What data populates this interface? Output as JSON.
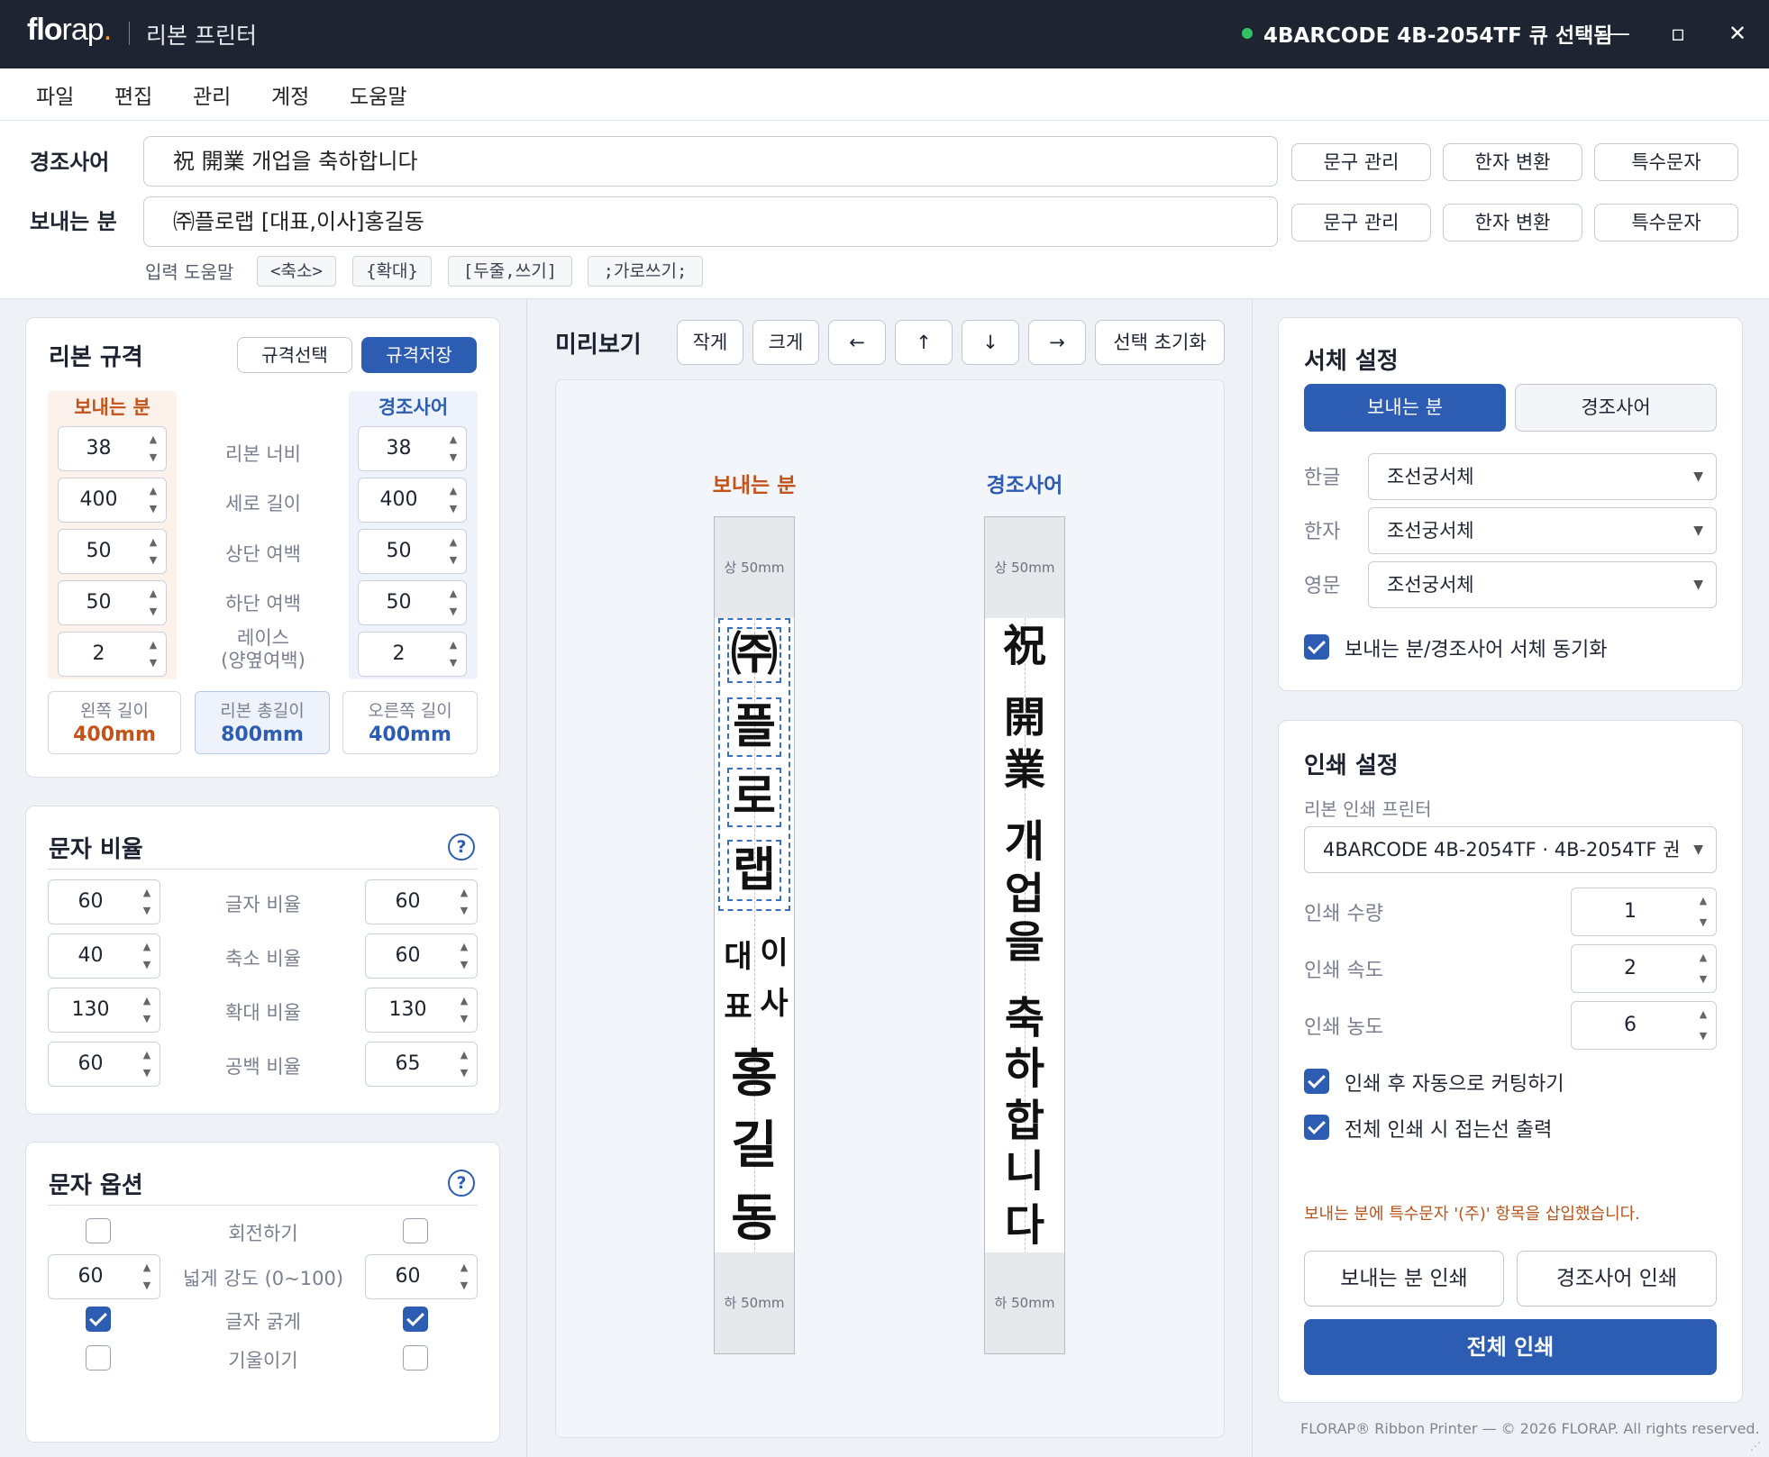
{
  "titlebar": {
    "logo_main": "flo",
    "logo_rest": "rap",
    "logo_dot": ".",
    "app_title": "리본 프린터",
    "printer_status": "4BARCODE 4B-2054TF 큐 선택됨",
    "minimize": "—",
    "maximize": "▫",
    "close": "✕",
    "status_color": "#31c264"
  },
  "menu": [
    "파일",
    "편집",
    "관리",
    "계정",
    "도움말"
  ],
  "inputs": {
    "condolence_label": "경조사어",
    "condolence_value": "祝 開業 개업을 축하합니다",
    "sender_label": "보내는 분",
    "sender_value": "㈜플로랩 [대표,이사]홍길동",
    "phrase_manage": "문구 관리",
    "hanja_convert": "한자 변환",
    "special_char": "특수문자",
    "help_label": "입력 도움말",
    "chips": [
      "<축소>",
      "{확대}",
      "[두줄,쓰기]",
      ";가로쓰기;"
    ]
  },
  "ribbon_spec": {
    "title": "리본 규격",
    "select_btn": "규격선택",
    "save_btn": "규격저장",
    "sender_head": "보내는 분",
    "condolence_head": "경조사어",
    "rows": [
      {
        "label": "리본 너비",
        "sender": "38",
        "condolence": "38"
      },
      {
        "label": "세로 길이",
        "sender": "400",
        "condolence": "400"
      },
      {
        "label": "상단 여백",
        "sender": "50",
        "condolence": "50"
      },
      {
        "label": "하단 여백",
        "sender": "50",
        "condolence": "50"
      },
      {
        "label": "레이스\n(양옆여백)",
        "sender": "2",
        "condolence": "2"
      }
    ],
    "left_len_label": "왼쪽 길이",
    "left_len": "400mm",
    "total_len_label": "리본 총길이",
    "total_len": "800mm",
    "right_len_label": "오른쪽 길이",
    "right_len": "400mm"
  },
  "char_ratio": {
    "title": "문자 비율",
    "help": "?",
    "rows": [
      {
        "label": "글자 비율",
        "left": "60",
        "right": "60"
      },
      {
        "label": "축소 비율",
        "left": "40",
        "right": "60"
      },
      {
        "label": "확대 비율",
        "left": "130",
        "right": "130"
      },
      {
        "label": "공백 비율",
        "left": "60",
        "right": "65"
      }
    ]
  },
  "char_options": {
    "title": "문자 옵션",
    "help": "?",
    "rotate_label": "회전하기",
    "rotate_left": false,
    "rotate_right": false,
    "spread_label": "넓게 강도 (0~100)",
    "spread_left": "60",
    "spread_right": "60",
    "bold_label": "글자 굵게",
    "bold_left": true,
    "bold_right": true,
    "italic_label": "기울이기",
    "italic_left": false,
    "italic_right": false
  },
  "preview": {
    "title": "미리보기",
    "smaller": "작게",
    "bigger": "크게",
    "left": "←",
    "up": "↑",
    "down": "↓",
    "right": "→",
    "reset": "선택 초기화",
    "sender_label": "보내는 분",
    "condolence_label": "경조사어",
    "top_margin": "상 50mm",
    "bottom_margin": "하 50mm",
    "sender_big": [
      "㈜",
      "플",
      "로",
      "랩"
    ],
    "sender_small_left": [
      "대",
      "표"
    ],
    "sender_small_right": [
      "이",
      "사"
    ],
    "sender_name": [
      "홍",
      "길",
      "동"
    ],
    "condolence_chars": [
      "祝",
      "開",
      "業",
      "개",
      "업",
      "을",
      "축",
      "하",
      "합",
      "니",
      "다"
    ]
  },
  "font_settings": {
    "title": "서체 설정",
    "tab_sender": "보내는 분",
    "tab_condolence": "경조사어",
    "rows": [
      {
        "label": "한글",
        "value": "조선궁서체"
      },
      {
        "label": "한자",
        "value": "조선궁서체"
      },
      {
        "label": "영문",
        "value": "조선궁서체"
      }
    ],
    "sync_label": "보내는 분/경조사어 서체 동기화",
    "sync_checked": true
  },
  "print_settings": {
    "title": "인쇄 설정",
    "printer_label": "리본 인쇄 프린터",
    "printer_value": "4BARCODE 4B-2054TF · 4B-2054TF 권",
    "qty_label": "인쇄 수량",
    "qty": "1",
    "speed_label": "인쇄 속도",
    "speed": "2",
    "density_label": "인쇄 농도",
    "density": "6",
    "auto_cut_label": "인쇄 후 자동으로 커팅하기",
    "auto_cut": true,
    "fold_line_label": "전체 인쇄 시 접는선 출력",
    "fold_line": true,
    "notice": "보내는 분에 특수문자 '(주)' 항목을 삽입했습니다.",
    "print_sender": "보내는 분 인쇄",
    "print_condolence": "경조사어 인쇄",
    "print_all": "전체 인쇄"
  },
  "footer": "FLORAP® Ribbon Printer — © 2026 FLORAP. All rights reserved.",
  "colors": {
    "accent": "#2d5db2",
    "sender_color": "#c2531b",
    "condolence_color": "#2d5db2",
    "titlebar": "#1e2432"
  }
}
